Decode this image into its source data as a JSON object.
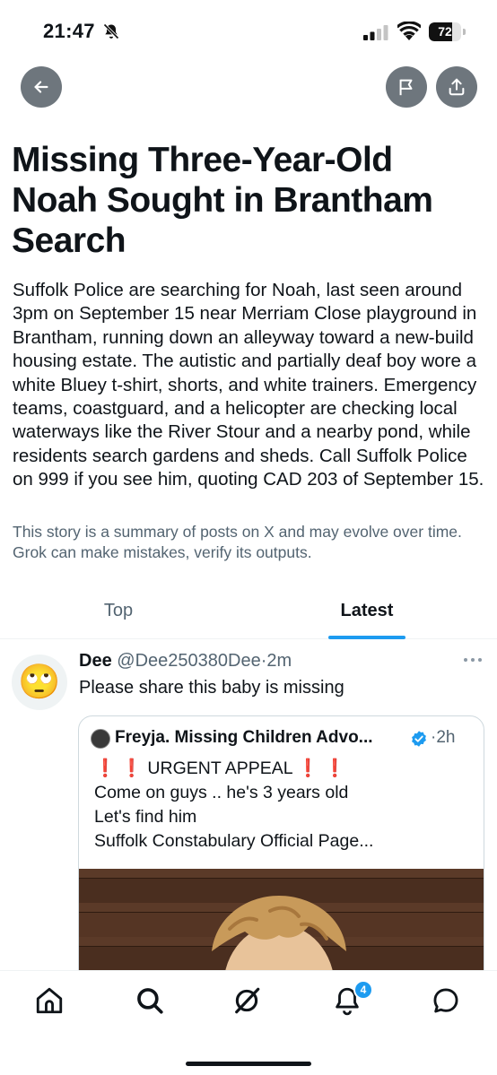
{
  "status_bar": {
    "time": "21:47",
    "battery": "72",
    "battery_level_percent": 72
  },
  "headline": "Missing Three-Year-Old Noah Sought in Brantham Search",
  "summary": "Suffolk Police are searching for Noah, last seen around 3pm on September 15 near Merriam Close playground in Brantham, running down an alleyway toward a new-build housing estate. The autistic and partially deaf boy wore a white Bluey t-shirt, shorts, and white trainers. Emergency teams, coastguard, and a helicopter are checking local waterways like the River Stour and a nearby pond, while residents search gardens and sheds. Call Suffolk Police on 999 if you see him, quoting CAD 203 of September 15.",
  "disclaimer": "This story is a summary of posts on X and may evolve over time. Grok can make mistakes, verify its outputs.",
  "tabs": [
    {
      "label": "Top",
      "active": false
    },
    {
      "label": "Latest",
      "active": true
    }
  ],
  "post": {
    "avatar_emoji": "🙄",
    "name": "Dee",
    "handle": "@Dee250380Dee",
    "separator": "·",
    "time": "2m",
    "text": "Please share this baby is missing",
    "quote": {
      "name": "Freyja. Missing Children Advo...",
      "separator": "·",
      "time": "2h",
      "exclaim": "❗",
      "appeal": "URGENT APPEAL",
      "lines": [
        "Come on guys .. he's 3 years old",
        "Let's find him",
        "Suffolk Constabulary Official Page..."
      ]
    }
  },
  "nav": {
    "notification_count": "4",
    "items": [
      "home-icon",
      "search-icon",
      "grok-icon",
      "notifications-icon",
      "messages-icon"
    ]
  },
  "colors": {
    "accent": "#1d9bf0",
    "secondary_text": "#536471",
    "primary_text": "#0f1419",
    "button_gray": "#6e767d",
    "alert_red": "#e0001b"
  }
}
